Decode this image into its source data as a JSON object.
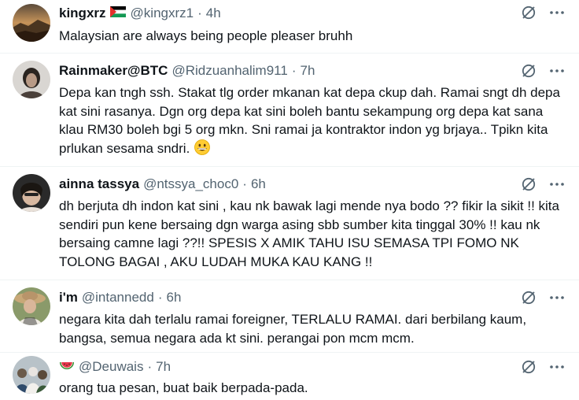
{
  "tweets": [
    {
      "name": "kingxrz",
      "flag": "palestine-flag",
      "handle": "@kingxrz1",
      "time": "4h",
      "text": "Malaysian are always being people pleaser bruhh",
      "avatar": "sunset-landscape-avatar"
    },
    {
      "name": "Rainmaker@BTC",
      "handle": "@Ridzuanhalim911",
      "time": "7h",
      "text": "Depa kan tngh ssh. Stakat tlg order mkanan kat depa ckup dah. Ramai sngt dh depa kat sini rasanya. Dgn org depa kat sini boleh bantu sekampung org depa kat sana klau RM30 boleh bgi 5 org mkn. Sni ramai ja kontraktor indon yg brjaya.. Tpikn kita prlukan sesama sndri.",
      "emoji": "grinning-face-emoji",
      "avatar": "portrait-avatar"
    },
    {
      "name": "ainna tassya",
      "handle": "@ntssya_choc0",
      "time": "6h",
      "text": "dh berjuta dh indon kat sini , kau nk bawak lagi mende nya bodo ?? fikir la sikit !! kita sendiri pun kene bersaing dgn warga asing sbb sumber kita tinggal 30% !! kau nk bersaing camne lagi ??!! SPESIS X AMIK TAHU ISU SEMASA TPI FOMO NK TOLONG BAGAI , AKU LUDAH MUKA KAU KANG !!",
      "avatar": "girl-avatar"
    },
    {
      "name": "i'm",
      "handle": "@intannedd",
      "time": "6h",
      "text": "negara kita dah terlalu ramai foreigner, TERLALU RAMAI. dari berbilang kaum, bangsa, semua negara ada kt sini. perangai pon mcm mcm.",
      "avatar": "hat-avatar"
    },
    {
      "name": "",
      "name_emoji": "watermelon-emoji",
      "handle": "@Deuwais",
      "time": "7h",
      "text": "orang tua pesan, buat baik berpada-pada.",
      "avatar": "group-avatar"
    }
  ],
  "separator": "·",
  "colors": {
    "text": "#0f1419",
    "secondary": "#536471",
    "border": "#eff3f4"
  }
}
